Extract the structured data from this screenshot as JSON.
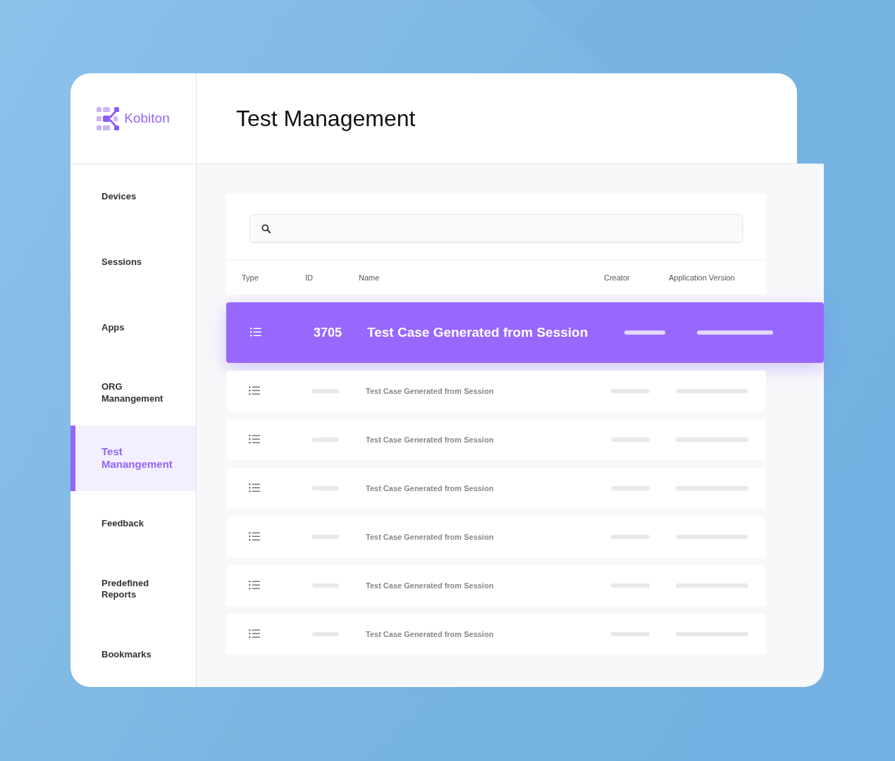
{
  "brand": "Kobiton",
  "title": "Test Management",
  "sidebar": {
    "items": [
      {
        "label": "Devices",
        "selected": false
      },
      {
        "label": "Sessions",
        "selected": false
      },
      {
        "label": "Apps",
        "selected": false
      },
      {
        "label": "ORG Manangement",
        "selected": false
      },
      {
        "label": "Test Manangement",
        "selected": true
      },
      {
        "label": "Feedback",
        "selected": false
      },
      {
        "label": "Predefined Reports",
        "selected": false
      },
      {
        "label": "Bookmarks",
        "selected": false
      }
    ]
  },
  "table": {
    "columns": [
      "Type",
      "ID",
      "Name",
      "Creator",
      "Application Version"
    ],
    "rows": [
      {
        "id": "3705",
        "name": "Test Case Generated from Session",
        "selected": true
      },
      {
        "name": "Test Case Generated from Session",
        "selected": false
      },
      {
        "name": "Test Case Generated from Session",
        "selected": false
      },
      {
        "name": "Test Case Generated from Session",
        "selected": false
      },
      {
        "name": "Test Case Generated from Session",
        "selected": false
      },
      {
        "name": "Test Case Generated from Session",
        "selected": false
      },
      {
        "name": "Test Case Generated from Session",
        "selected": false
      }
    ]
  }
}
